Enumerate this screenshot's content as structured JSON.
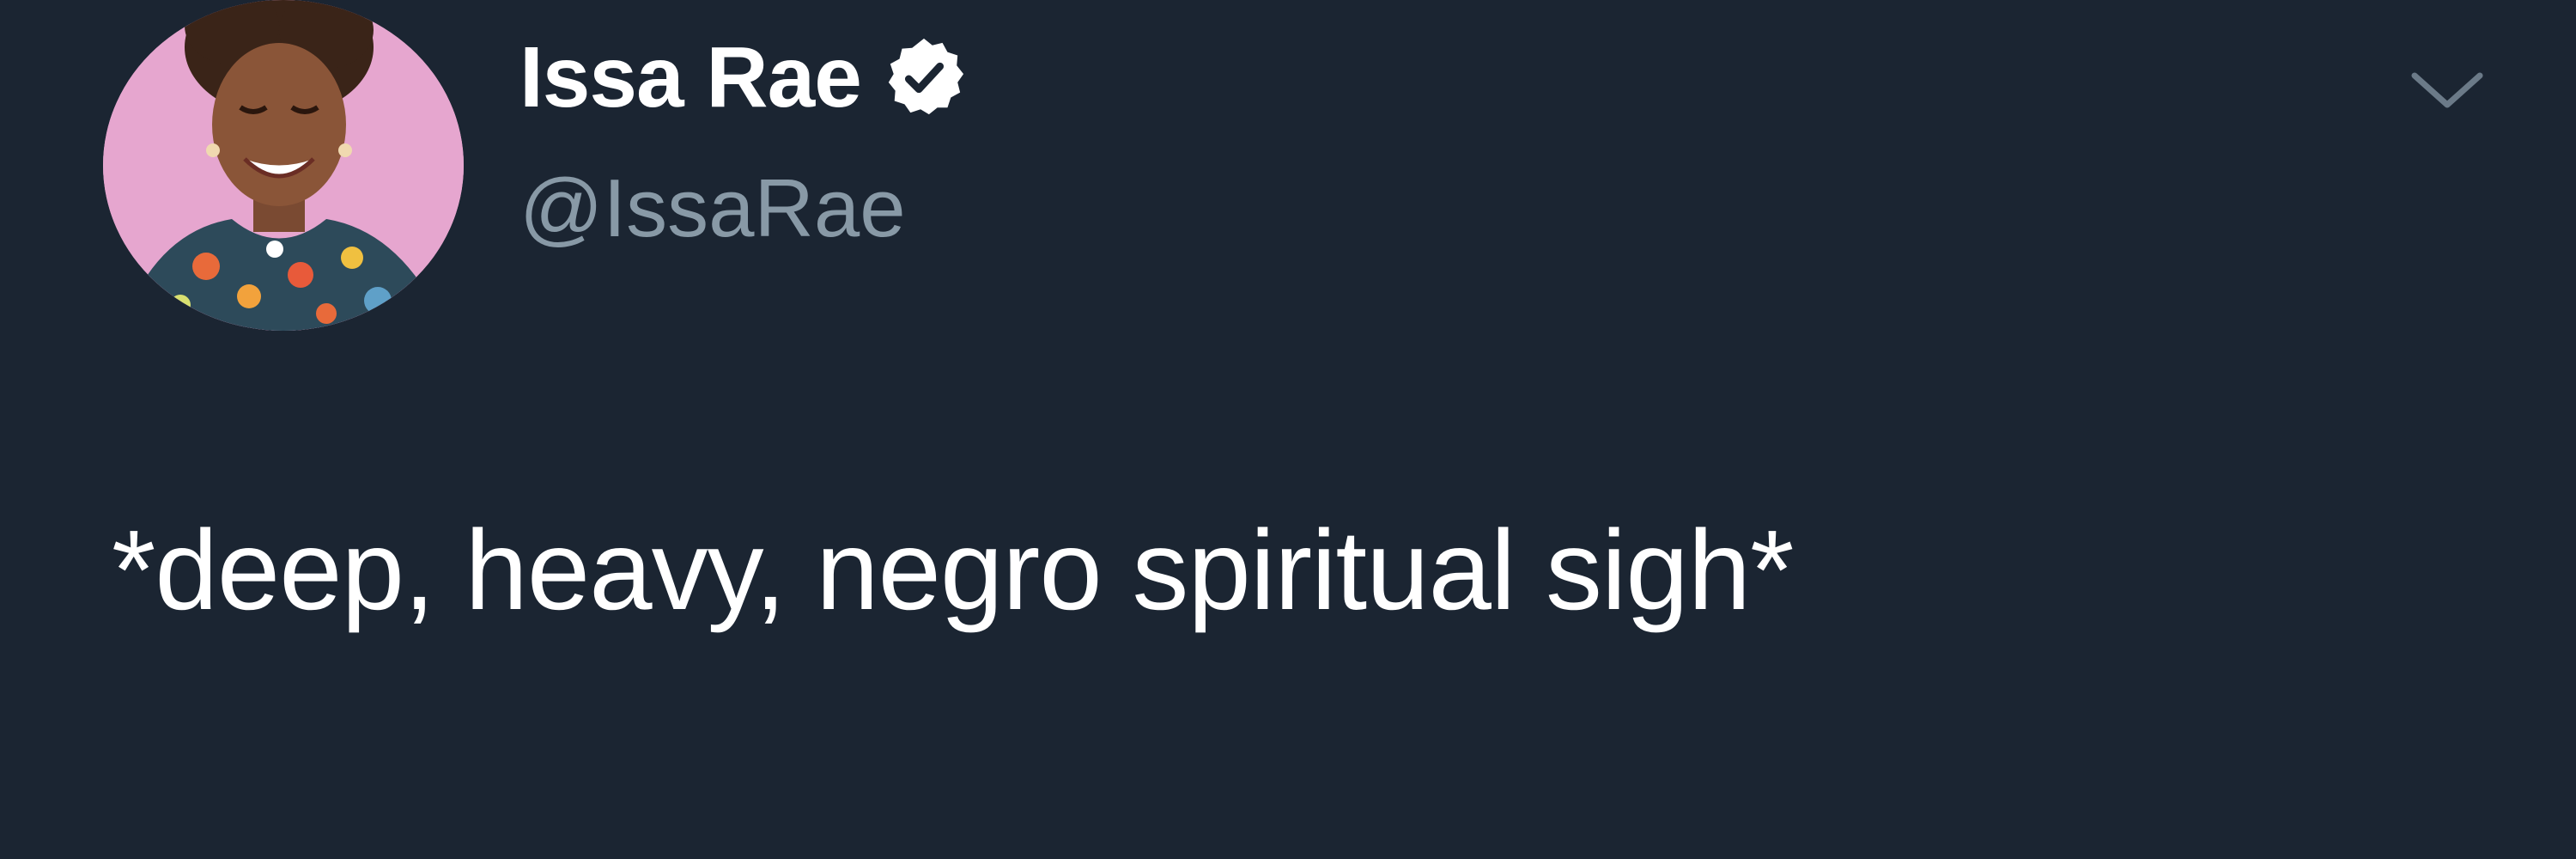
{
  "user": {
    "display_name": "Issa Rae",
    "handle": "@IssaRae",
    "verified": true,
    "avatar_icon": "profile-photo"
  },
  "tweet": {
    "text": "*deep, heavy, negro spiritual sigh*"
  },
  "header": {
    "menu_icon": "chevron-down-icon"
  },
  "colors": {
    "background": "#1b2532",
    "text_primary": "#ffffff",
    "text_secondary": "#8899a6"
  }
}
